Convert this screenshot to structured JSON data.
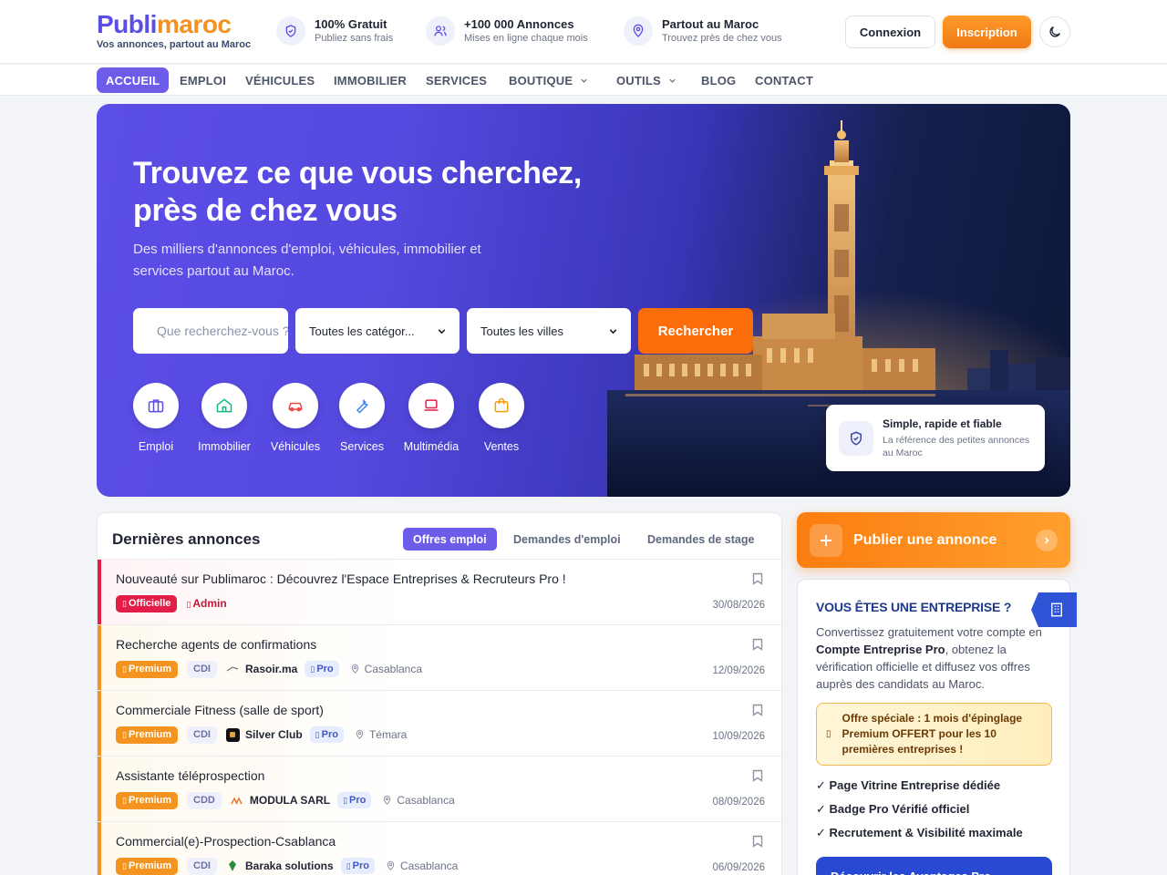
{
  "header": {
    "logo_part1": "Publi",
    "logo_part2": "maroc",
    "tagline": "Vos annonces, partout au Maroc",
    "features": [
      {
        "title": "100% Gratuit",
        "subtitle": "Publiez sans frais",
        "icon": "shield-icon"
      },
      {
        "title": "+100 000 Annonces",
        "subtitle": "Mises en ligne chaque mois",
        "icon": "users-icon"
      },
      {
        "title": "Partout au Maroc",
        "subtitle": "Trouvez près de chez vous",
        "icon": "map-pin-icon"
      }
    ],
    "login_label": "Connexion",
    "signup_label": "Inscription",
    "theme_icon": "moon-icon"
  },
  "nav": {
    "items": [
      {
        "label": "ACCUEIL"
      },
      {
        "label": "EMPLOI"
      },
      {
        "label": "VÉHICULES"
      },
      {
        "label": "IMMOBILIER"
      },
      {
        "label": "SERVICES"
      },
      {
        "label": "BOUTIQUE"
      },
      {
        "label": "OUTILS"
      },
      {
        "label": "BLOG"
      },
      {
        "label": "CONTACT"
      }
    ]
  },
  "hero": {
    "title_line1": "Trouvez ce que vous cherchez,",
    "title_line2": "près de chez vous",
    "subtitle": "Des milliers d'annonces d'emploi, véhicules, immobilier et services partout au Maroc.",
    "search_placeholder": "Que recherchez-vous ?",
    "category_select": "Toutes les catégor...",
    "city_select": "Toutes les villes",
    "search_button": "Rechercher",
    "categories": [
      {
        "label": "Emploi",
        "icon": "briefcase-icon",
        "color": "#5b4ee6"
      },
      {
        "label": "Immobilier",
        "icon": "home-icon",
        "color": "#10b981"
      },
      {
        "label": "Véhicules",
        "icon": "car-icon",
        "color": "#ef4444"
      },
      {
        "label": "Services",
        "icon": "wrench-icon",
        "color": "#3b82f6"
      },
      {
        "label": "Multimédia",
        "icon": "laptop-icon",
        "color": "#e11d48"
      },
      {
        "label": "Ventes",
        "icon": "shopping-bag-icon",
        "color": "#f59e0b"
      }
    ],
    "trust_title": "Simple, rapide et fiable",
    "trust_subtitle": "La référence des petites annonces au Maroc"
  },
  "listings": {
    "title": "Dernières annonces",
    "tabs": [
      "Offres emploi",
      "Demandes d'emploi",
      "Demandes de stage"
    ],
    "rows": [
      {
        "title": "Nouveauté sur Publimaroc : Découvrez l'Espace Entreprises & Recruteurs Pro !",
        "badge": "Officielle",
        "author": "Admin",
        "date": "30/08/2026"
      },
      {
        "title": "Recherche agents de confirmations",
        "badge": "Premium",
        "contract": "CDI",
        "company": "Rasoir.ma",
        "pro": "Pro",
        "city": "Casablanca",
        "date": "12/09/2026"
      },
      {
        "title": "Commerciale Fitness (salle de sport)",
        "badge": "Premium",
        "contract": "CDI",
        "company": "Silver Club",
        "pro": "Pro",
        "city": "Témara",
        "date": "10/09/2026"
      },
      {
        "title": "Assistante téléprospection",
        "badge": "Premium",
        "contract": "CDD",
        "company": "MODULA SARL",
        "pro": "Pro",
        "city": "Casablanca",
        "date": "08/09/2026"
      },
      {
        "title": "Commercial(e)-Prospection-Csablanca",
        "badge": "Premium",
        "contract": "CDI",
        "company": "Baraka solutions",
        "pro": "Pro",
        "city": "Casablanca",
        "date": "06/09/2026"
      }
    ]
  },
  "sidebar": {
    "publish_label": "Publier une annonce",
    "biz_title": "VOUS ÊTES UNE ENTREPRISE ?",
    "biz_text_1": "Convertissez gratuitement votre compte en ",
    "biz_text_bold": "Compte Entreprise Pro",
    "biz_text_2": ", obtenez la vérification officielle et diffusez vos offres auprès des candidats au Maroc.",
    "offer_text": "Offre spéciale : 1 mois d'épinglage Premium OFFERT pour les 10 premières entreprises !",
    "perks": [
      "✓ Page Vitrine Entreprise dédiée",
      "✓ Badge Pro Vérifié officiel",
      "✓ Recrutement & Visibilité maximale"
    ],
    "cta_label": "Découvrir les Avantages Pro"
  },
  "colors": {
    "primary": "#6c5ce7",
    "accent": "#f39220",
    "search_button": "#fa6d0a",
    "official": "#e11d48",
    "pro_blue": "#2849d3"
  }
}
